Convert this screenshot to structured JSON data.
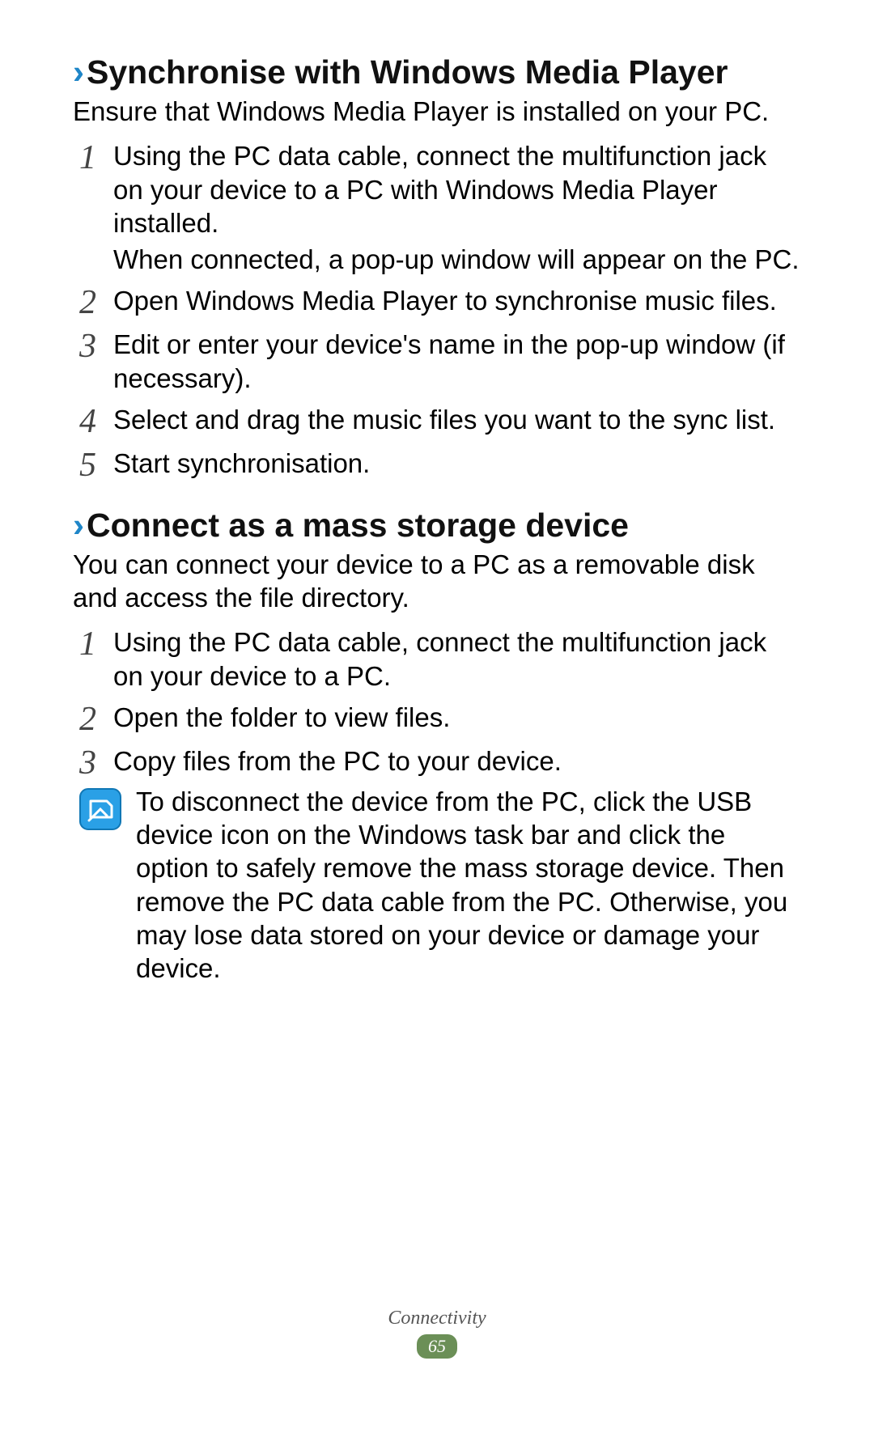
{
  "section1": {
    "heading": "Synchronise with Windows Media Player",
    "intro": "Ensure that Windows Media Player is installed on your PC.",
    "steps": [
      {
        "num": "1",
        "lines": [
          "Using the PC data cable, connect the multifunction jack on your device to a PC with Windows Media Player installed.",
          "When connected, a pop-up window will appear on the PC."
        ]
      },
      {
        "num": "2",
        "lines": [
          "Open Windows Media Player to synchronise music files."
        ]
      },
      {
        "num": "3",
        "lines": [
          "Edit or enter your device's name in the pop-up window (if necessary)."
        ]
      },
      {
        "num": "4",
        "lines": [
          "Select and drag the music files you want to the sync list."
        ]
      },
      {
        "num": "5",
        "lines": [
          "Start synchronisation."
        ]
      }
    ]
  },
  "section2": {
    "heading": "Connect as a mass storage device",
    "intro": "You can connect your device to a PC as a removable disk and access the file directory.",
    "steps": [
      {
        "num": "1",
        "lines": [
          "Using the PC data cable, connect the multifunction jack on your device to a PC."
        ]
      },
      {
        "num": "2",
        "lines": [
          "Open the folder to view files."
        ]
      },
      {
        "num": "3",
        "lines": [
          "Copy files from the PC to your device."
        ]
      }
    ],
    "note": "To disconnect the device from the PC, click the USB device icon on the Windows task bar and click the option to safely remove the mass storage device. Then remove the PC data cable from the PC. Otherwise, you may lose data stored on your device or damage your device."
  },
  "footer": {
    "label": "Connectivity",
    "page": "65"
  },
  "chevron": "›"
}
